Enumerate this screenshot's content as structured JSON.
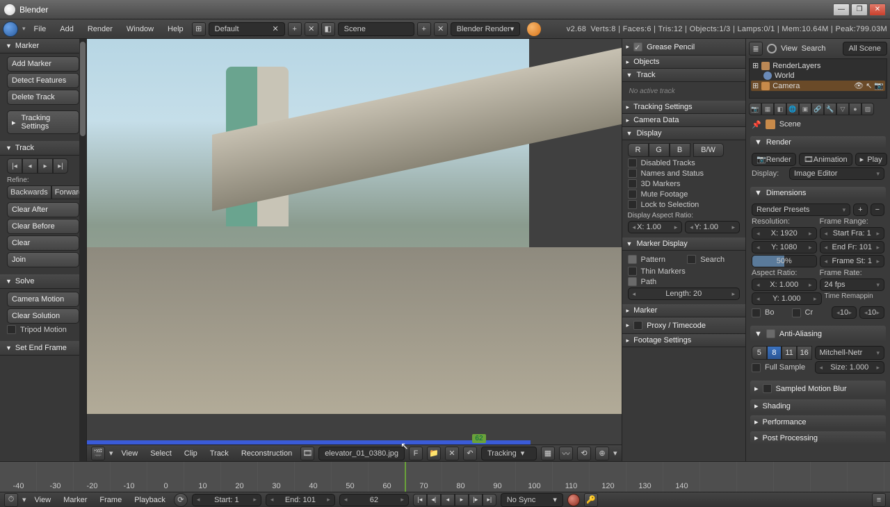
{
  "titlebar": {
    "title": "Blender"
  },
  "menubar": {
    "items": [
      "File",
      "Add",
      "Render",
      "Window",
      "Help"
    ],
    "layout": "Default",
    "scene": "Scene",
    "engine": "Blender Render",
    "version": "v2.68",
    "stats": "Verts:8 | Faces:6 | Tris:12 | Objects:1/3 | Lamps:0/1 | Mem:10.64M | Peak:799.03M"
  },
  "left": {
    "marker": {
      "title": "Marker",
      "add": "Add Marker",
      "detect": "Detect Features",
      "del": "Delete Track",
      "settings": "Tracking Settings"
    },
    "track": {
      "title": "Track",
      "refine": "Refine:",
      "backwards": "Backwards",
      "forwards": "Forwards",
      "clearafter": "Clear After",
      "clearbefore": "Clear Before",
      "clear": "Clear",
      "join": "Join"
    },
    "solve": {
      "title": "Solve",
      "cam": "Camera Motion",
      "clr": "Clear Solution",
      "tripod": "Tripod Motion",
      "setend": "Set End Frame"
    }
  },
  "right": {
    "gp": "Grease Pencil",
    "obj": "Objects",
    "trk": "Track",
    "noact": "No active track",
    "ts": "Tracking Settings",
    "cd": "Camera Data",
    "disp": "Display",
    "r": "R",
    "g": "G",
    "b": "B",
    "bw": "B/W",
    "dt": "Disabled Tracks",
    "ns": "Names and Status",
    "mk": "3D Markers",
    "mf": "Mute Footage",
    "ls": "Lock to Selection",
    "dar": "Display Aspect Ratio:",
    "x": "X: 1.00",
    "y": "Y: 1.00",
    "md": "Marker Display",
    "pat": "Pattern",
    "sr": "Search",
    "tm": "Thin Markers",
    "pth": "Path",
    "len": "Length: 20",
    "marker": "Marker",
    "pt": "Proxy / Timecode",
    "fs": "Footage Settings"
  },
  "props": {
    "search": "Search",
    "all": "All Scene",
    "outliner": {
      "rl": "RenderLayers",
      "world": "World",
      "cam": "Camera"
    },
    "crumb": "Scene",
    "render": {
      "h": "Render",
      "render": "Render",
      "anim": "Animation",
      "play": "Play",
      "displab": "Display:",
      "disp": "Image Editor"
    },
    "dim": {
      "h": "Dimensions",
      "preset": "Render Presets",
      "reslab": "Resolution:",
      "x": "X: 1920",
      "y": "Y: 1080",
      "pct": "50%",
      "frlab": "Frame Range:",
      "fs": "Start Fra: 1",
      "fe": "End Fr: 101",
      "fst": "Frame St: 1",
      "arlab": "Aspect Ratio:",
      "ax": "X: 1.000",
      "ay": "Y: 1.000",
      "frr": "Frame Rate:",
      "fps": "24 fps",
      "trm": "Time Remappin",
      "bo": "Bo",
      "cr": "Cr",
      "o": "10",
      "n": "10"
    },
    "aa": {
      "h": "Anti-Aliasing",
      "s5": "5",
      "s8": "8",
      "s11": "11",
      "s16": "16",
      "filt": "Mitchell-Netr",
      "full": "Full Sample",
      "size": "Size: 1.000"
    },
    "smb": "Sampled Motion Blur",
    "sh": "Shading",
    "pf": "Performance",
    "pp": "Post Processing"
  },
  "clipbar": {
    "view": "View",
    "select": "Select",
    "clip": "Clip",
    "track": "Track",
    "recon": "Reconstruction",
    "file": "elevator_01_0380.jpg",
    "f": "F",
    "mode": "Tracking"
  },
  "viewport": {
    "frame": "62"
  },
  "timelineA": {
    "ticks": [
      "-40",
      "-30",
      "-20",
      "-10",
      "0",
      "10",
      "20",
      "30",
      "40",
      "50",
      "60",
      "70",
      "80",
      "90",
      "100",
      "110",
      "120",
      "130",
      "140"
    ]
  },
  "timebar": {
    "view": "View",
    "marker": "Marker",
    "frame": "Frame",
    "playback": "Playback",
    "start": "Start: 1",
    "end": "End: 101",
    "cur": "62",
    "sync": "No Sync"
  }
}
